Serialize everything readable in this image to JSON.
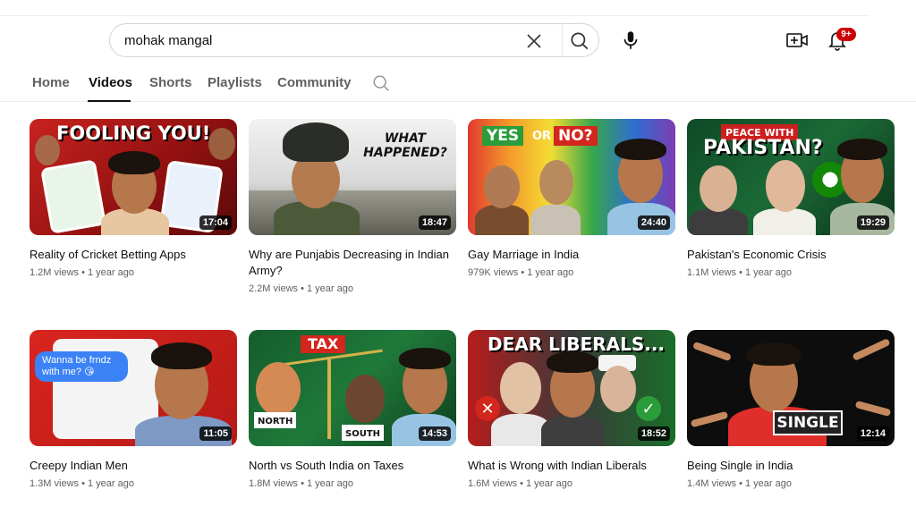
{
  "search": {
    "query": "mohak mangal"
  },
  "notifications": {
    "badge": "9+"
  },
  "tabs": [
    {
      "label": "Home"
    },
    {
      "label": "Videos"
    },
    {
      "label": "Shorts"
    },
    {
      "label": "Playlists"
    },
    {
      "label": "Community"
    }
  ],
  "videos": [
    {
      "title": "Reality of Cricket Betting Apps",
      "views": "1.2M views",
      "age": "1 year ago",
      "duration": "17:04",
      "thumb_text": "FOOLING YOU!"
    },
    {
      "title": "Why are Punjabis Decreasing in Indian Army?",
      "views": "2.2M views",
      "age": "1 year ago",
      "duration": "18:47",
      "thumb_text": "WHAT HAPPENED?"
    },
    {
      "title": "Gay Marriage in India",
      "views": "979K views",
      "age": "1 year ago",
      "duration": "24:40",
      "thumb_text_a": "YES",
      "thumb_text_b": "OR",
      "thumb_text_c": "NO?"
    },
    {
      "title": "Pakistan's Economic Crisis",
      "views": "1.1M views",
      "age": "1 year ago",
      "duration": "19:29",
      "thumb_text_a": "PEACE WITH",
      "thumb_text_b": "PAKISTAN?"
    },
    {
      "title": "Creepy Indian Men",
      "views": "1.3M views",
      "age": "1 year ago",
      "duration": "11:05",
      "thumb_text": "Wanna be frndz with me? 😘"
    },
    {
      "title": "North vs South India on Taxes",
      "views": "1.8M views",
      "age": "1 year ago",
      "duration": "14:53",
      "thumb_text_a": "TAX",
      "thumb_text_b": "NORTH",
      "thumb_text_c": "SOUTH"
    },
    {
      "title": "What is Wrong with Indian Liberals",
      "views": "1.6M views",
      "age": "1 year ago",
      "duration": "18:52",
      "thumb_text": "DEAR LIBERALS..."
    },
    {
      "title": "Being Single in India",
      "views": "1.4M views",
      "age": "1 year ago",
      "duration": "12:14",
      "thumb_text": "SINGLE"
    }
  ],
  "colors": {
    "accent": "#cc0000",
    "text": "#0f0f0f",
    "muted": "#606060"
  }
}
